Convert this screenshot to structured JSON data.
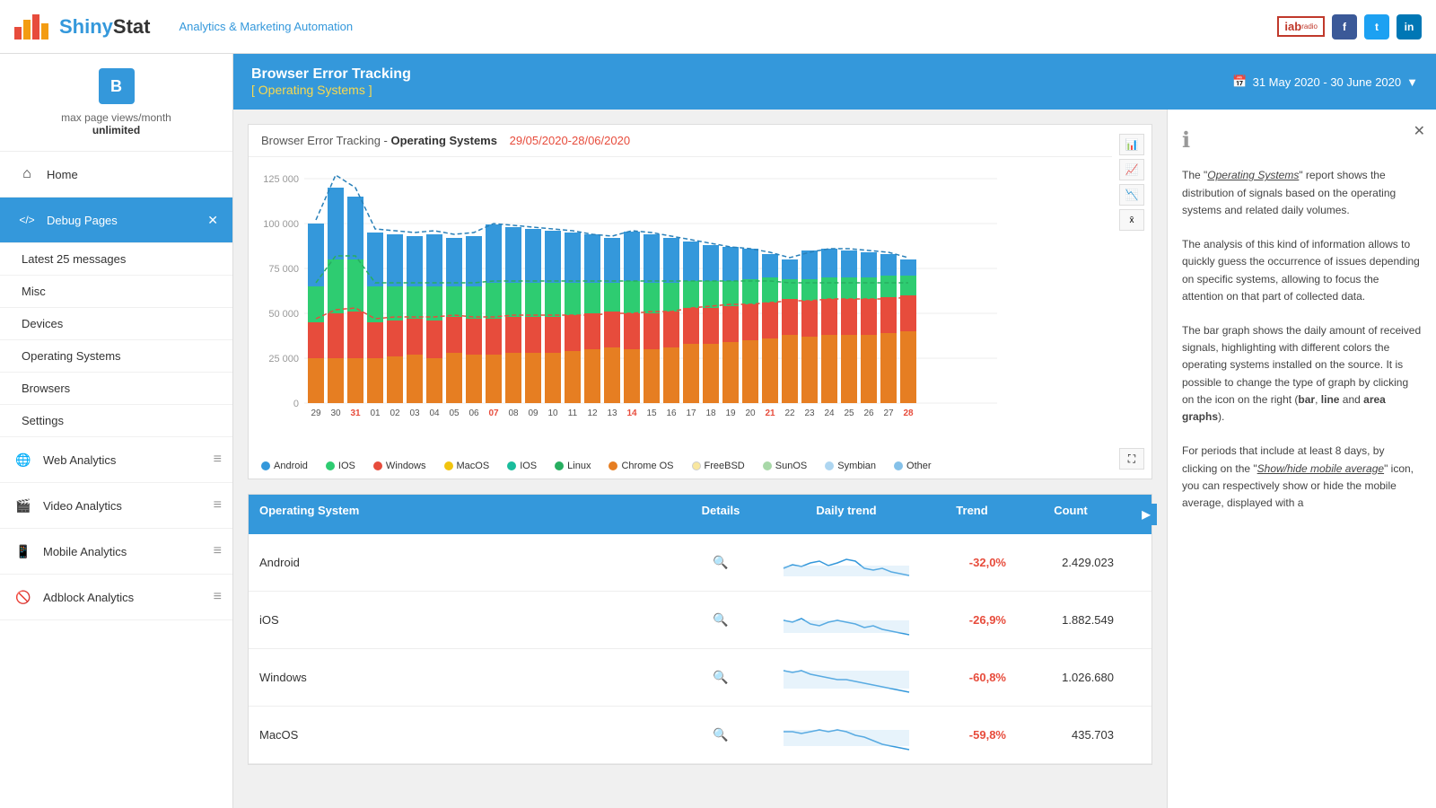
{
  "header": {
    "logo_name": "ShinyS",
    "logo_highlight": "tat",
    "subtitle": "Analytics & Marketing Automation",
    "social": [
      "f",
      "t",
      "in"
    ]
  },
  "sidebar": {
    "profile": {
      "icon": "B",
      "max_label": "max page views/month",
      "max_value": "unlimited"
    },
    "nav": [
      {
        "icon": "⌂",
        "label": "Home",
        "active": false
      },
      {
        "icon": "</>",
        "label": "Debug Pages",
        "active": true,
        "closable": true
      }
    ],
    "subnav": [
      "Latest 25 messages",
      "Misc",
      "Devices",
      "Operating Systems",
      "Browsers",
      "Settings"
    ],
    "analytics": [
      {
        "icon": "🌐",
        "label": "Web Analytics"
      },
      {
        "icon": "🎬",
        "label": "Video Analytics"
      },
      {
        "icon": "📱",
        "label": "Mobile Analytics"
      },
      {
        "icon": "🚫",
        "label": "Adblock Analytics"
      }
    ]
  },
  "top_bar": {
    "title": "Browser Error Tracking",
    "subtitle": "[ Operating Systems ]",
    "date_range": "31 May 2020 - 30 June 2020"
  },
  "chart": {
    "title": "Browser Error Tracking - Operating Systems",
    "date": "29/05/2020-28/06/2020",
    "legend": [
      {
        "label": "Android",
        "color": "#3498db"
      },
      {
        "label": "IOS",
        "color": "#2ecc71"
      },
      {
        "label": "Windows",
        "color": "#e74c3c"
      },
      {
        "label": "MacOS",
        "color": "#f1c40f"
      },
      {
        "label": "IOS",
        "color": "#1abc9c"
      },
      {
        "label": "Linux",
        "color": "#27ae60"
      },
      {
        "label": "Chrome OS",
        "color": "#e67e22"
      },
      {
        "label": "FreeBSD",
        "color": "#f9e79f"
      },
      {
        "label": "SunOS",
        "color": "#a8d8a8"
      },
      {
        "label": "Symbian",
        "color": "#aed6f1"
      },
      {
        "label": "Other",
        "color": "#85c1e9"
      }
    ],
    "x_labels": [
      "29",
      "30",
      "31",
      "01",
      "02",
      "03",
      "04",
      "05",
      "06",
      "07",
      "08",
      "09",
      "10",
      "11",
      "12",
      "13",
      "14",
      "15",
      "16",
      "17",
      "18",
      "19",
      "20",
      "21",
      "22",
      "23",
      "24",
      "25",
      "26",
      "27",
      "28"
    ],
    "red_labels": [
      "31",
      "07",
      "14",
      "21",
      "28"
    ]
  },
  "table": {
    "headers": [
      "Operating System",
      "Details",
      "Daily trend",
      "Trend",
      "Count",
      ""
    ],
    "rows": [
      {
        "os": "Android",
        "trend": "-32,0%",
        "count": "2.429.023"
      },
      {
        "os": "iOS",
        "trend": "-26,9%",
        "count": "1.882.549"
      },
      {
        "os": "Windows",
        "trend": "-60,8%",
        "count": "1.026.680"
      },
      {
        "os": "MacOS",
        "trend": "-59,8%",
        "count": "435.703"
      }
    ]
  },
  "info_panel": {
    "para1": "The \"Operating Systems\" report shows the distribution of signals based on the operating systems and related daily volumes.",
    "para2": "The analysis of this kind of information allows to quickly guess the occurrence of issues depending on specific systems, allowing to focus the attention on that part of collected data.",
    "para3": "The bar graph shows the daily amount of received signals, highlighting with different colors the operating systems installed on the source. It is possible to change the type of graph by clicking on the icon on the right (bar, line and area graphs).",
    "para4": "For periods that include at least 8 days, by clicking on the \"Show/hide mobile average\" icon, you can respectively show or hide the mobile average, displayed with a"
  }
}
